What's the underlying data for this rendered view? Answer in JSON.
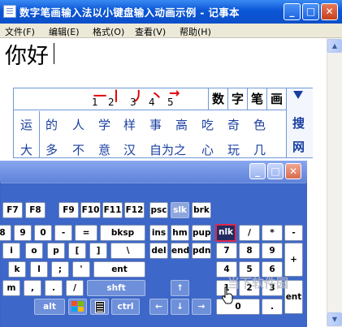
{
  "window": {
    "title": "数字笔画输入法以小键盘输入动画示例 - 记事本",
    "min_label": "_",
    "max_label": "□",
    "close_label": "✕"
  },
  "menu": [
    {
      "label": "文件(F)"
    },
    {
      "label": "编辑(E)"
    },
    {
      "label": "格式(O)"
    },
    {
      "label": "查看(V)"
    },
    {
      "label": "帮助(H)"
    }
  ],
  "editor": {
    "text": "你好"
  },
  "ime": {
    "strokes": [
      {
        "symbol": "一",
        "num": "1"
      },
      {
        "symbol": "丨",
        "num": "2"
      },
      {
        "symbol": "丿",
        "num": "3"
      },
      {
        "symbol": "丶",
        "num": "4"
      },
      {
        "symbol": "→",
        "num": "5"
      }
    ],
    "modes": [
      "数",
      "字",
      "笔",
      "画"
    ],
    "row2": [
      "运",
      "的",
      "人",
      "学",
      "样",
      "事",
      "高",
      "吃",
      "奇",
      "色"
    ],
    "row3": [
      "大",
      "多",
      "不",
      "意",
      "汉",
      "自为之",
      "心",
      "玩",
      "几"
    ],
    "side": {
      "search": "搜",
      "net": "网"
    }
  },
  "keyboard": {
    "win_min": "_",
    "win_max": "□",
    "win_close": "✕",
    "keys": {
      "r1": [
        "F7",
        "F8",
        "F9",
        "F10",
        "F11",
        "F12",
        "psc",
        "slk",
        "brk"
      ],
      "r2": [
        "8",
        "9",
        "0",
        "-",
        "=",
        "bksp",
        "ins",
        "hm",
        "pup",
        "nlk",
        "/",
        "*",
        "-"
      ],
      "r3": [
        "i",
        "o",
        "p",
        "[",
        "]",
        "\\",
        "del",
        "end",
        "pdn",
        "7",
        "8",
        "9",
        "+"
      ],
      "r4": [
        "k",
        "l",
        ";",
        "'",
        "ent",
        "4",
        "5",
        "6"
      ],
      "r5": [
        "m",
        ",",
        ".",
        "/",
        "shft",
        "↑",
        "1",
        "2",
        "3",
        "ent"
      ],
      "r6": [
        "alt",
        "ctrl",
        "←",
        "↓",
        "→",
        "0",
        "."
      ]
    },
    "selected_key": "nlk"
  },
  "watermark": "当下软件园"
}
